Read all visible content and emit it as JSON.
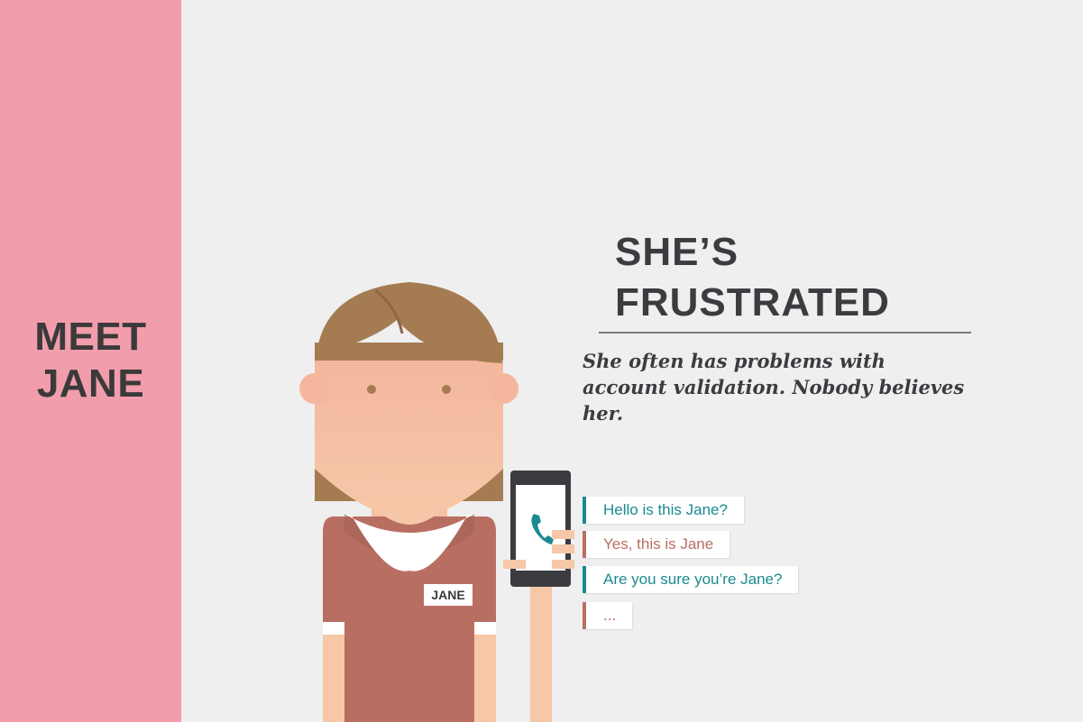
{
  "sidebar": {
    "line1": "MEET",
    "line2": "JANE",
    "color": "#f29dac"
  },
  "headline": {
    "line1": "SHE’S",
    "line2": "FRUSTRATED"
  },
  "description": "She often has problems with account validation. Nobody believes her.",
  "name_badge": "JANE",
  "conversation": [
    {
      "text": "Hello is this Jane?",
      "speaker": "caller"
    },
    {
      "text": "Yes, this is Jane",
      "speaker": "jane"
    },
    {
      "text": "Are you sure you’re Jane?",
      "speaker": "caller"
    },
    {
      "text": "...",
      "speaker": "jane"
    }
  ],
  "colors": {
    "background": "#efefef",
    "teal": "#1a8a90",
    "rose": "#b86f62",
    "shirt": "#b86f62",
    "hair": "#a57b52",
    "skin": "#f5c2a3",
    "text_dark": "#3b3c40"
  }
}
